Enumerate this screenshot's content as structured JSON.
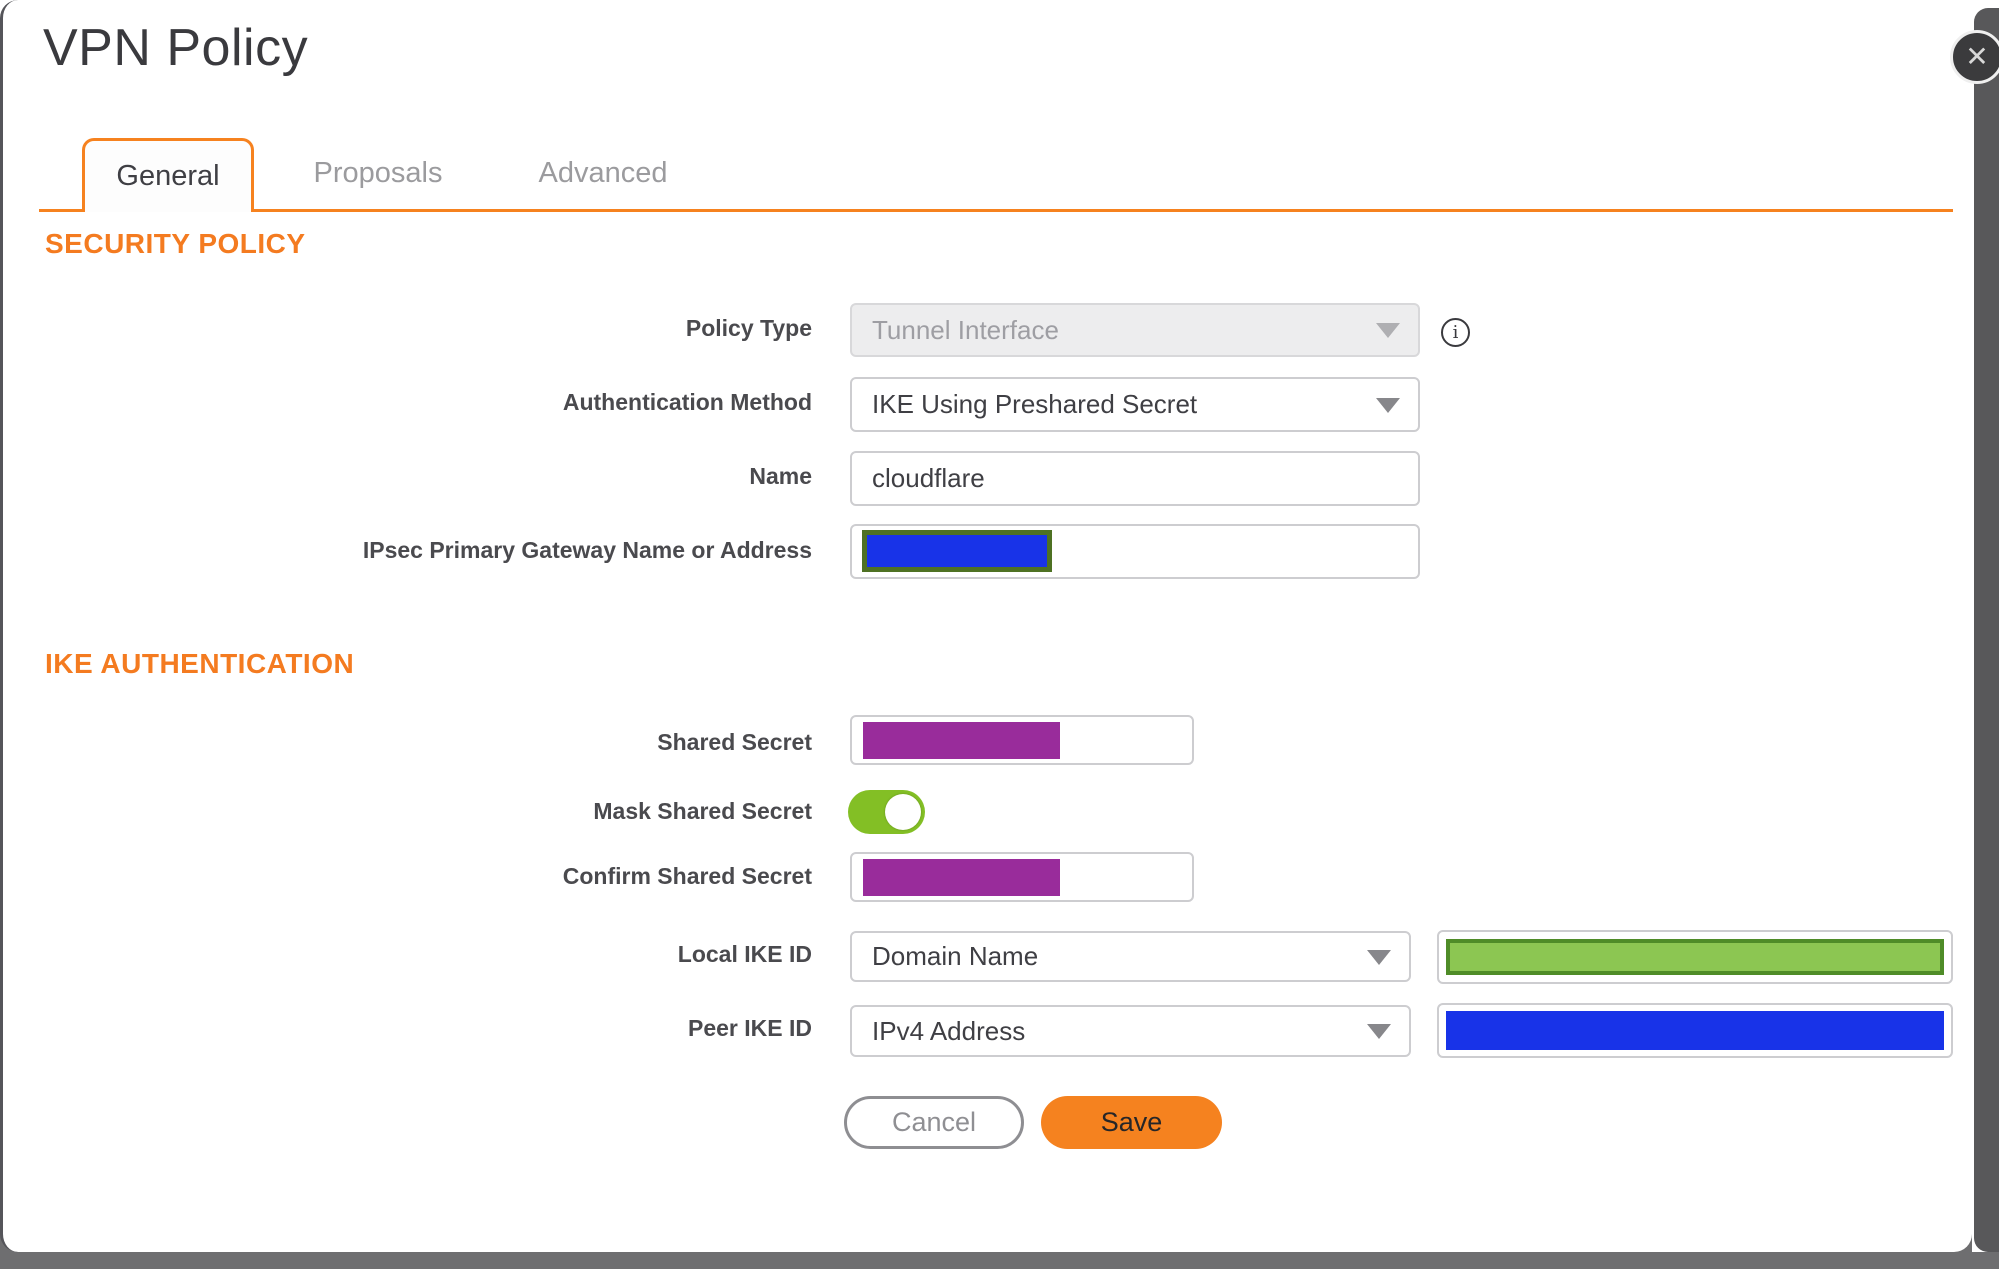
{
  "dialog": {
    "title": "VPN Policy",
    "close_glyph": "✕"
  },
  "tabs": [
    {
      "label": "General",
      "active": true
    },
    {
      "label": "Proposals",
      "active": false
    },
    {
      "label": "Advanced",
      "active": false
    }
  ],
  "headings": {
    "security_policy": "SECURITY POLICY",
    "ike_authentication": "IKE AUTHENTICATION"
  },
  "fields": {
    "policy_type": {
      "label": "Policy Type",
      "value": "Tunnel Interface",
      "state": "disabled"
    },
    "authentication_method": {
      "label": "Authentication Method",
      "value": "IKE Using Preshared Secret"
    },
    "name": {
      "label": "Name",
      "value": "cloudflare"
    },
    "ipsec_primary_gateway": {
      "label": "IPsec Primary Gateway Name or Address",
      "value_redacted": true
    },
    "shared_secret": {
      "label": "Shared Secret",
      "value_redacted": true
    },
    "mask_shared_secret": {
      "label": "Mask Shared Secret",
      "state": "on"
    },
    "confirm_shared_secret": {
      "label": "Confirm Shared Secret",
      "value_redacted": true
    },
    "local_ike_id": {
      "label": "Local IKE ID",
      "value": "Domain Name",
      "id_value_redacted": true
    },
    "peer_ike_id": {
      "label": "Peer IKE ID",
      "value": "IPv4 Address",
      "id_value_redacted": true
    }
  },
  "buttons": {
    "cancel": "Cancel",
    "save": "Save"
  },
  "colors": {
    "accent_orange": "#F6821F",
    "heading_orange": "#F47B20",
    "toggle_green": "#83BF25",
    "redaction_purple": "#992C9B",
    "redaction_blue": "#1833E8",
    "redaction_green": "#8CC652",
    "redaction_green_border": "#4F8C28",
    "redaction_olive_border": "#4E7123"
  }
}
